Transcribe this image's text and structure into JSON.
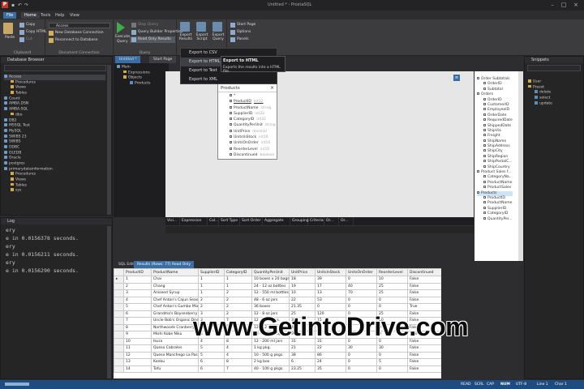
{
  "app": {
    "title": "Untitled * - ProstaSQL"
  },
  "menu": {
    "file": "File",
    "home": "Home",
    "tools": "Tools",
    "help": "Help",
    "view": "View"
  },
  "ribbon": {
    "clipboard": {
      "label": "Clipboard",
      "paste": "Paste",
      "copy": "Copy",
      "copy_html": "Copy HTML",
      "cut": "Cut"
    },
    "connection": {
      "label": "Document Connection",
      "access": "Access",
      "new_db": "New Database Connection",
      "reconnect": "Reconnect to Database"
    },
    "query": {
      "label": "Query",
      "execute": "Execute",
      "query": "Query",
      "stop": "Stop Query",
      "builder": "Query Builder Properties",
      "readonly": "Read Only Results"
    },
    "export": {
      "results": "Export Results",
      "script": "Export Script",
      "query": "Export Query"
    },
    "windows": {
      "label": "Windows",
      "start_page": "Start Page",
      "options": "Options",
      "panels": "Panels"
    }
  },
  "export_menu": {
    "items": [
      "Export to CSV",
      "Export to HTML",
      "Export to Text",
      "Export to XML"
    ],
    "tooltip_title": "Export to HTML",
    "tooltip_text": "Exports the results into a HTML file."
  },
  "db_browser": {
    "title": "Database Browser",
    "items": [
      "Access",
      "Procedures",
      "Views",
      "Tables",
      "Count",
      "AMBA.DSN",
      "AMBA-SQL",
      "dbo",
      "DB2",
      "MSSQL Test",
      "MySQL",
      "SWIBS 23",
      "SWIBS",
      "ODBC",
      "OLEDB",
      "Oracle",
      "postgres",
      "primarydatainformation",
      "Procedures",
      "Views",
      "Tables",
      "sys"
    ]
  },
  "log": {
    "title": "Log",
    "lines": [
      "ery",
      "e in 0.0156378 seconds.",
      "ery",
      "e in 0.0156211 seconds.",
      "ery",
      "e in 0.0156290 seconds."
    ]
  },
  "doc_tabs": {
    "untitled": "Untitled *",
    "start": "Start Page"
  },
  "query_tree": {
    "main": "Main",
    "expressions": "Expressions",
    "objects": "Objects",
    "products": "Products"
  },
  "products_table": {
    "title": "Products",
    "fields": [
      "*",
      "ProductID",
      "ProductName",
      "SupplierID",
      "CategoryID",
      "QuantityPerUnit",
      "UnitPrice",
      "UnitsInStock",
      "UnitsOnOrder",
      "ReorderLevel",
      "Discontinued"
    ],
    "types": [
      "",
      "int32",
      "string",
      "int32",
      "int32",
      "string",
      "decimal",
      "int16",
      "int16",
      "int16",
      "boolean"
    ]
  },
  "criteria_grid": {
    "columns": [
      "Visi...",
      "Expression",
      "Col...",
      "Sort Type",
      "Sort Order",
      "Aggregate",
      "Grouping",
      "Criteria",
      "Or...",
      "Or..."
    ]
  },
  "schema": {
    "items": [
      "Order Subtotals",
      "OrderID",
      "Subtotal",
      "Orders",
      "OrderID",
      "CustomerID",
      "EmployeeID",
      "OrderDate",
      "RequiredDate",
      "ShippedDate",
      "ShipVia",
      "Freight",
      "ShipName",
      "ShipAddress",
      "ShipCity",
      "ShipRegion",
      "ShipPostalC...",
      "ShipCountry",
      "Product Sales f...",
      "CategoryNa...",
      "ProductName",
      "ProductSales",
      "Products",
      "ProductID",
      "ProductName",
      "SupplierID",
      "CategoryID",
      "QuantityPer..."
    ]
  },
  "snippets": {
    "title": "Snippets",
    "items": [
      "User",
      "Preset",
      "delete",
      "select",
      "update"
    ]
  },
  "results_tabs": {
    "sql": "SQL Edit",
    "results": "Results (Rows: 77) Read Only"
  },
  "results": {
    "columns": [
      "ProductID",
      "ProductName",
      "SupplierID",
      "CategoryID",
      "QuantityPerUnit",
      "UnitPrice",
      "UnitsInStock",
      "UnitsOnOrder",
      "ReorderLevel",
      "Discontinued"
    ],
    "rows": [
      [
        "1",
        "Chai",
        "1",
        "1",
        "10 boxes x 20 bags",
        "18",
        "39",
        "0",
        "10",
        "False"
      ],
      [
        "2",
        "Chang",
        "1",
        "1",
        "24 - 12 oz bottles",
        "19",
        "17",
        "40",
        "25",
        "False"
      ],
      [
        "3",
        "Aniseed Syrup",
        "1",
        "2",
        "12 - 550 ml bottles",
        "10",
        "13",
        "70",
        "25",
        "False"
      ],
      [
        "4",
        "Chef Anton's Cajun Seasoning",
        "2",
        "2",
        "48 - 6 oz jars",
        "22",
        "53",
        "0",
        "0",
        "False"
      ],
      [
        "5",
        "Chef Anton's Gumbo Mix",
        "2",
        "2",
        "36 boxes",
        "21.35",
        "0",
        "0",
        "0",
        "True"
      ],
      [
        "6",
        "Grandma's Boysenberry Spread",
        "3",
        "2",
        "12 - 8 oz jars",
        "25",
        "120",
        "0",
        "25",
        "False"
      ],
      [
        "7",
        "Uncle Bob's Organic Dried Pears",
        "3",
        "7",
        "12 - 1 lb pkgs.",
        "30",
        "15",
        "0",
        "10",
        "False"
      ],
      [
        "8",
        "Northwoods Cranberry Sauce",
        "3",
        "2",
        "12 - 12 oz jars",
        "40",
        "6",
        "0",
        "0",
        "False"
      ],
      [
        "9",
        "Mishi Kobe Niku",
        "4",
        "6",
        "18 - 500 g pkgs.",
        "97",
        "29",
        "0",
        "0",
        "True"
      ],
      [
        "10",
        "Ikura",
        "4",
        "8",
        "12 - 200 ml jars",
        "31",
        "31",
        "0",
        "0",
        "False"
      ],
      [
        "11",
        "Queso Cabrales",
        "5",
        "4",
        "1 kg pkg.",
        "21",
        "22",
        "30",
        "30",
        "False"
      ],
      [
        "12",
        "Queso Manchego La Pastora",
        "5",
        "4",
        "10 - 500 g pkgs.",
        "38",
        "86",
        "0",
        "0",
        "False"
      ],
      [
        "13",
        "Konbu",
        "6",
        "8",
        "2 kg box",
        "6",
        "24",
        "0",
        "5",
        "False"
      ],
      [
        "14",
        "Tofu",
        "6",
        "7",
        "40 - 100 g pkgs.",
        "23.25",
        "35",
        "0",
        "0",
        "False"
      ]
    ]
  },
  "status": {
    "items": [
      "READ",
      "SCRL",
      "CAP",
      "NUM",
      "UTF-8",
      "Line 1",
      "Char 1"
    ]
  },
  "watermark": "www.GetintoDrive.com"
}
